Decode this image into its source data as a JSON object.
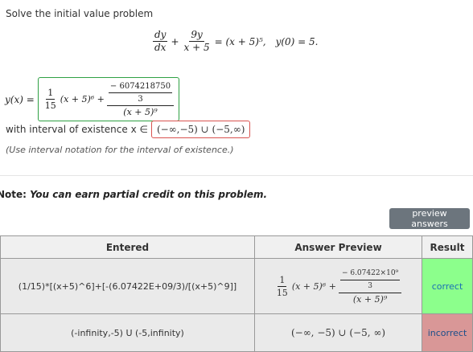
{
  "problem": {
    "prompt": "Solve the initial value problem",
    "ode": {
      "lhs1_num": "dy",
      "lhs1_den": "dx",
      "plus": "+",
      "lhs2_num": "9y",
      "lhs2_den": "x + 5",
      "rhs": "= (x + 5)⁵,",
      "ic": "y(0) = 5."
    }
  },
  "answer": {
    "y_label": "y(x) =",
    "term1_num": "1",
    "term1_den": "15",
    "term1_rest": "(x + 5)⁶ +",
    "term2_num_top": "− 6074218750",
    "term2_num_bottom": "3",
    "term2_den": "(x + 5)⁹"
  },
  "interval": {
    "label": "with interval of existence x ∈",
    "value": "(−∞,−5) ∪ (−5,∞)",
    "hint": "(Use interval notation for the interval of existence.)"
  },
  "note": {
    "prefix": "Note:",
    "text": "You can earn partial credit on this problem."
  },
  "preview_button": "preview answers",
  "results": {
    "headers": [
      "Entered",
      "Answer Preview",
      "Result"
    ],
    "rows": [
      {
        "entered": "(1/15)*[(x+5)^6]+[-(6.07422E+09/3)/[(x+5)^9]]",
        "preview": {
          "a_num": "1",
          "a_den": "15",
          "a_rest": "(x + 5)⁶ +",
          "b_top": "− 6.07422×10⁹",
          "b_mid": "3",
          "b_den": "(x + 5)⁹"
        },
        "result": "correct"
      },
      {
        "entered": "(-infinity,-5) U (-5,infinity)",
        "preview_text": "(−∞, −5) ∪ (−5, ∞)",
        "result": "incorrect"
      }
    ]
  },
  "colors": {
    "correct_bg": "#8cff8c",
    "incorrect_bg": "#d99797",
    "green_border": "#2ea043",
    "red_border": "#d9534f",
    "button_bg": "#6c757d"
  }
}
